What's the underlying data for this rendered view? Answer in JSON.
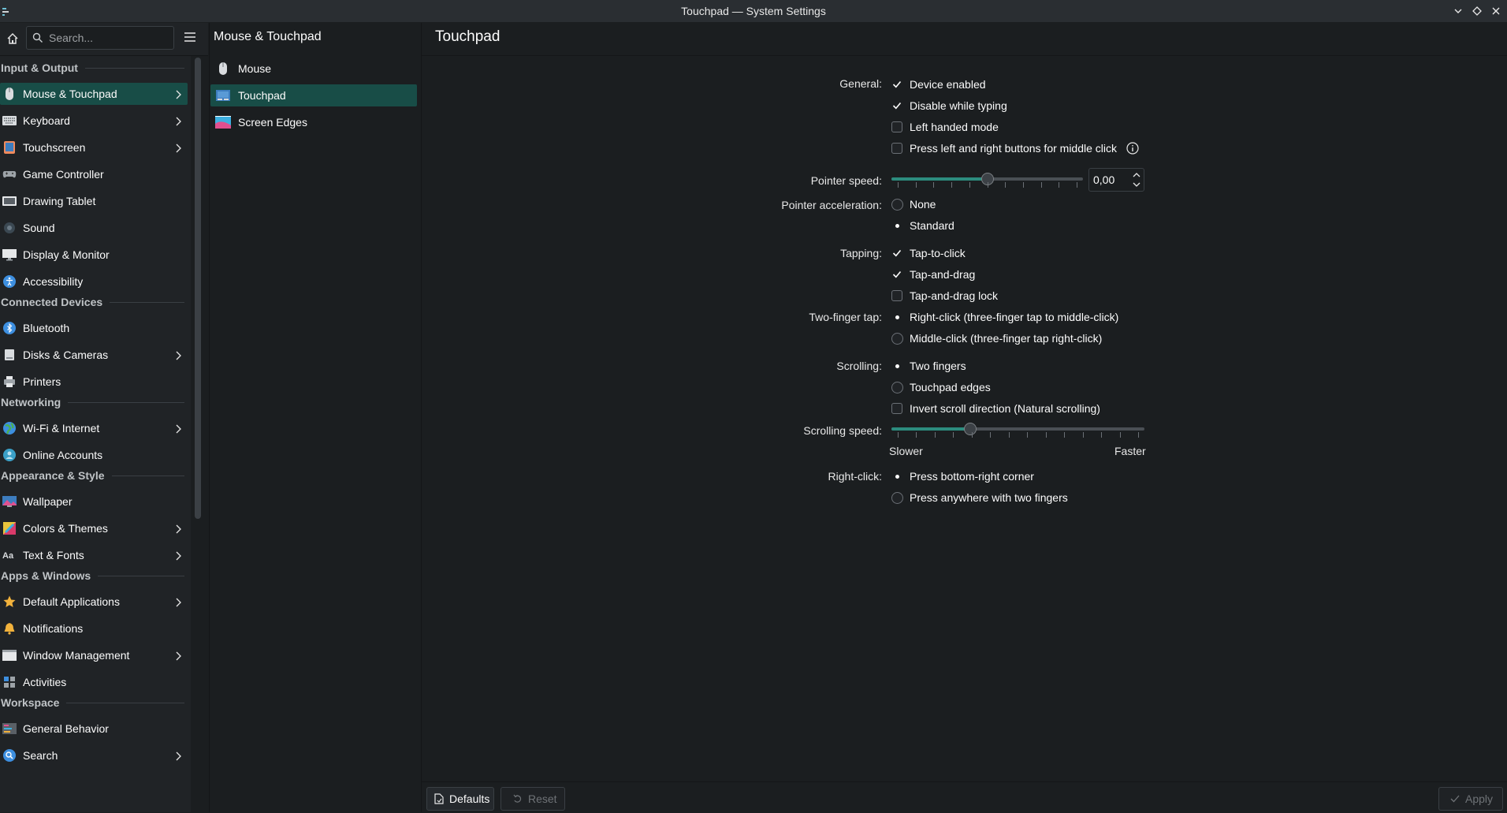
{
  "window": {
    "title": "Touchpad — System Settings",
    "controls": [
      "minimize-icon",
      "maximize-icon",
      "close-icon"
    ]
  },
  "search": {
    "placeholder": "Search..."
  },
  "sidebar": {
    "sections": [
      {
        "header": "Input & Output",
        "items": [
          {
            "label": "Mouse & Touchpad",
            "icon": "mouse-icon",
            "chevron": true,
            "selected": true
          },
          {
            "label": "Keyboard",
            "icon": "keyboard-icon",
            "chevron": true
          },
          {
            "label": "Touchscreen",
            "icon": "touchscreen-icon",
            "chevron": true
          },
          {
            "label": "Game Controller",
            "icon": "gamepad-icon",
            "chevron": false
          },
          {
            "label": "Drawing Tablet",
            "icon": "tablet-icon",
            "chevron": false
          },
          {
            "label": "Sound",
            "icon": "speaker-icon",
            "chevron": false
          },
          {
            "label": "Display & Monitor",
            "icon": "monitor-icon",
            "chevron": false
          },
          {
            "label": "Accessibility",
            "icon": "accessibility-icon",
            "chevron": false
          }
        ]
      },
      {
        "header": "Connected Devices",
        "items": [
          {
            "label": "Bluetooth",
            "icon": "bluetooth-icon",
            "chevron": false
          },
          {
            "label": "Disks & Cameras",
            "icon": "disk-icon",
            "chevron": true
          },
          {
            "label": "Printers",
            "icon": "printer-icon",
            "chevron": false
          }
        ]
      },
      {
        "header": "Networking",
        "items": [
          {
            "label": "Wi-Fi & Internet",
            "icon": "globe-icon",
            "chevron": true
          },
          {
            "label": "Online Accounts",
            "icon": "online-accounts-icon",
            "chevron": false
          }
        ]
      },
      {
        "header": "Appearance & Style",
        "items": [
          {
            "label": "Wallpaper",
            "icon": "wallpaper-icon",
            "chevron": false
          },
          {
            "label": "Colors & Themes",
            "icon": "colors-icon",
            "chevron": true
          },
          {
            "label": "Text & Fonts",
            "icon": "fonts-icon",
            "chevron": true
          }
        ]
      },
      {
        "header": "Apps & Windows",
        "items": [
          {
            "label": "Default Applications",
            "icon": "star-icon",
            "chevron": true
          },
          {
            "label": "Notifications",
            "icon": "bell-icon",
            "chevron": false
          },
          {
            "label": "Window Management",
            "icon": "window-icon",
            "chevron": true
          },
          {
            "label": "Activities",
            "icon": "activities-icon",
            "chevron": false
          }
        ]
      },
      {
        "header": "Workspace",
        "items": [
          {
            "label": "General Behavior",
            "icon": "general-behavior-icon",
            "chevron": false
          },
          {
            "label": "Search",
            "icon": "search-icon",
            "chevron": true
          }
        ]
      }
    ]
  },
  "middle": {
    "header": "Mouse & Touchpad",
    "items": [
      {
        "label": "Mouse",
        "icon": "mouse-icon"
      },
      {
        "label": "Touchpad",
        "icon": "touchpad-icon",
        "selected": true
      },
      {
        "label": "Screen Edges",
        "icon": "screen-edges-icon"
      }
    ]
  },
  "main": {
    "title": "Touchpad",
    "labels": {
      "general": "General:",
      "pointer_speed": "Pointer speed:",
      "pointer_acceleration": "Pointer acceleration:",
      "tapping": "Tapping:",
      "two_finger_tap": "Two-finger tap:",
      "scrolling": "Scrolling:",
      "scrolling_speed": "Scrolling speed:",
      "right_click": "Right-click:"
    },
    "general": {
      "device_enabled": {
        "label": "Device enabled",
        "checked": true
      },
      "disable_while_typing": {
        "label": "Disable while typing",
        "checked": true
      },
      "left_handed": {
        "label": "Left handed mode",
        "checked": false
      },
      "middle_click_emulation": {
        "label": "Press left and right buttons for middle click",
        "checked": false
      }
    },
    "pointer_speed": {
      "value_text": "0,00",
      "level": 0.5
    },
    "acceleration": {
      "none": {
        "label": "None",
        "selected": false
      },
      "standard": {
        "label": "Standard",
        "selected": true
      }
    },
    "tapping": {
      "tap_to_click": {
        "label": "Tap-to-click",
        "checked": true
      },
      "tap_and_drag": {
        "label": "Tap-and-drag",
        "checked": true
      },
      "tap_and_drag_lock": {
        "label": "Tap-and-drag lock",
        "checked": false
      }
    },
    "two_finger_tap": {
      "right_click": {
        "label": "Right-click (three-finger tap to middle-click)",
        "selected": true
      },
      "middle_click": {
        "label": "Middle-click (three-finger tap right-click)",
        "selected": false
      }
    },
    "scrolling": {
      "two_fingers": {
        "label": "Two fingers",
        "selected": true
      },
      "edges": {
        "label": "Touchpad edges",
        "selected": false
      },
      "natural": {
        "label": "Invert scroll direction (Natural scrolling)",
        "checked": false
      }
    },
    "scrolling_speed": {
      "level": 0.3,
      "min_label": "Slower",
      "max_label": "Faster"
    },
    "right_click": {
      "corner": {
        "label": "Press bottom-right corner",
        "selected": true
      },
      "two_fingers": {
        "label": "Press anywhere with two fingers",
        "selected": false
      }
    }
  },
  "footer": {
    "defaults": "Defaults",
    "reset": "Reset",
    "apply": "Apply"
  },
  "colors": {
    "accent": "#2c8c7e",
    "selection": "#184d47",
    "background": "#1b1e20",
    "sidebar": "#202326"
  }
}
